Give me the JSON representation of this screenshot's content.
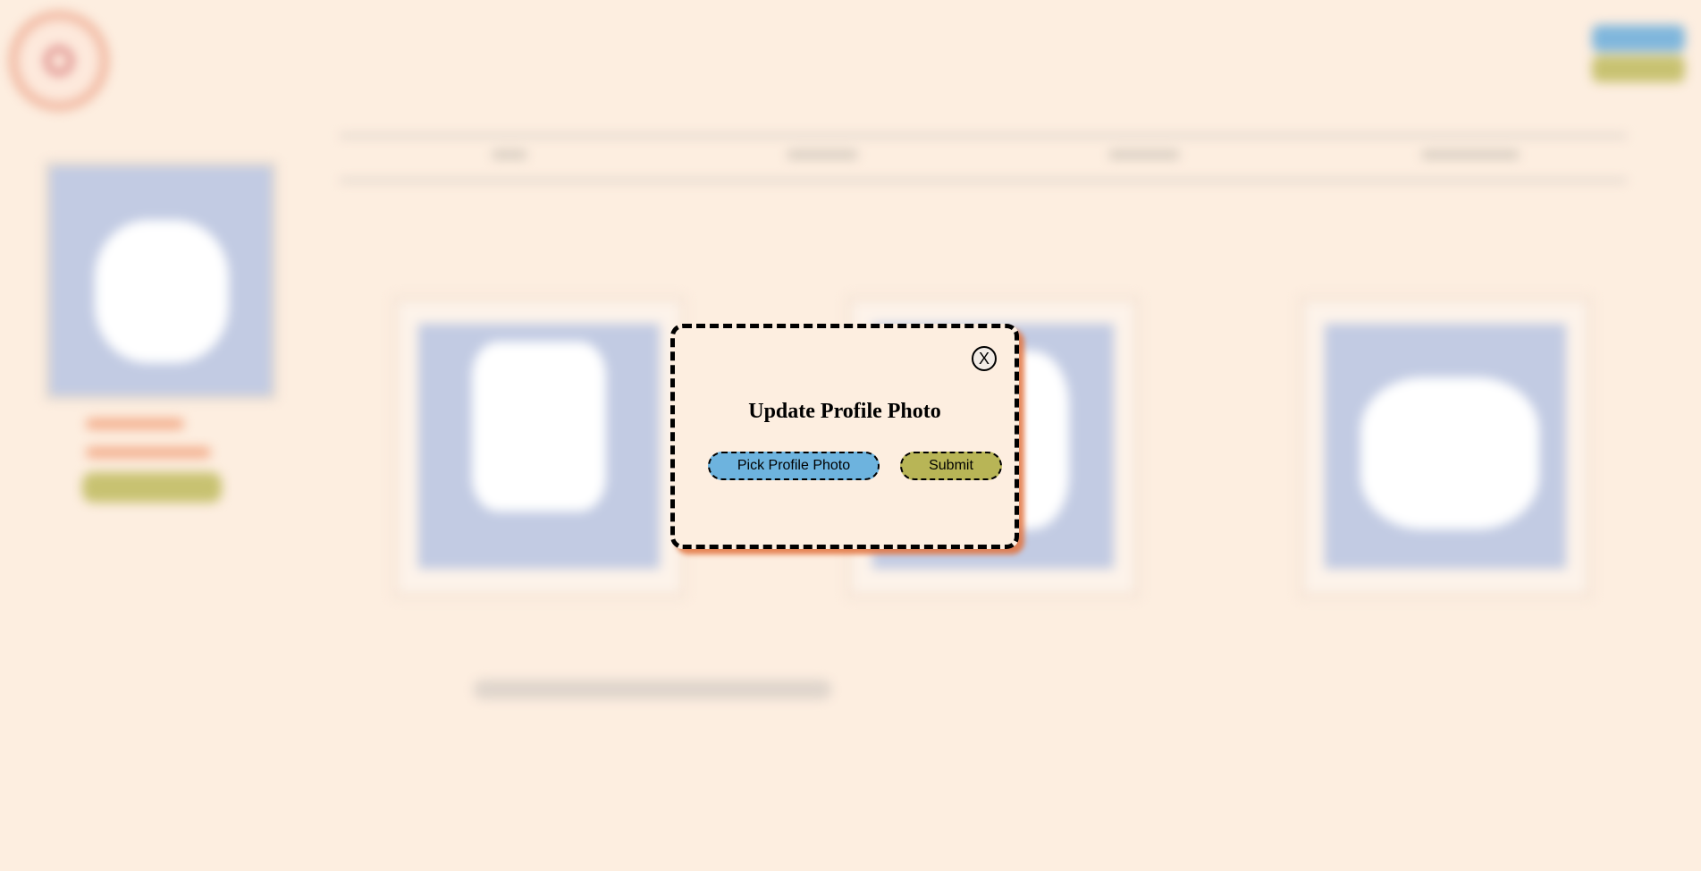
{
  "modal": {
    "title": "Update Profile Photo",
    "close_label": "X",
    "pick_button": "Pick Profile Photo",
    "submit_button": "Submit"
  },
  "colors": {
    "page_background": "#fdeee0",
    "pick_button": "#6db3de",
    "submit_button": "#b8b556",
    "modal_shadow": "#e2723d"
  },
  "background_icons": [
    "logo-icon",
    "close-icon"
  ]
}
